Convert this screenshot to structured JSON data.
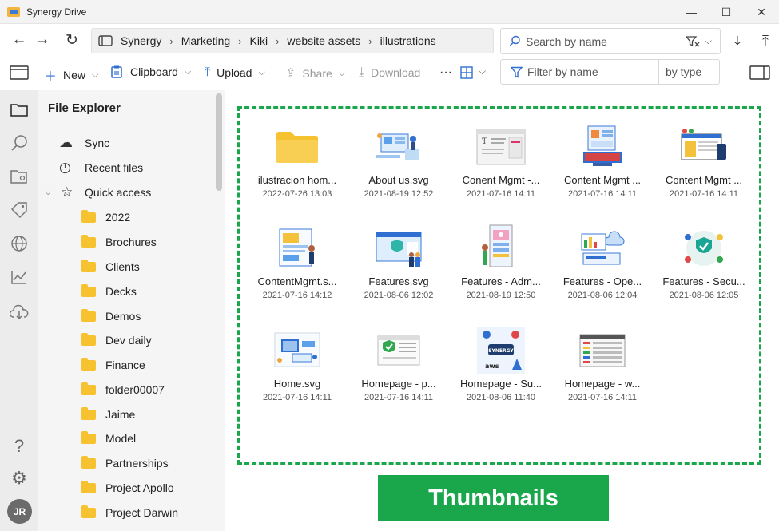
{
  "window": {
    "title": "Synergy Drive",
    "minimize": "—",
    "maximize": "☐",
    "close": "✕"
  },
  "nav": {
    "back": "←",
    "forward": "→",
    "refresh": "↻",
    "breadcrumb": [
      "Synergy",
      "Marketing",
      "Kiki",
      "website assets",
      "illustrations"
    ],
    "search_placeholder": "Search by name",
    "download": "⤓",
    "upload": "⤒"
  },
  "toolbar": {
    "new_label": "New",
    "clipboard_label": "Clipboard",
    "upload_label": "Upload",
    "share_label": "Share",
    "download_label": "Download",
    "more": "···",
    "filter_placeholder": "Filter by name",
    "type_label": "by type"
  },
  "sidebar": {
    "title": "File Explorer",
    "sync": "Sync",
    "recent": "Recent files",
    "quick_access": "Quick access",
    "folders": [
      "2022",
      "Brochures",
      "Clients",
      "Decks",
      "Demos",
      "Dev daily",
      "Finance",
      "folder00007",
      "Jaime",
      "Model",
      "Partnerships",
      "Project Apollo",
      "Project Darwin"
    ]
  },
  "user": {
    "initials": "JR"
  },
  "files": [
    {
      "name": "ilustracion hom...",
      "date": "2022-07-26 13:03",
      "kind": "folder"
    },
    {
      "name": "About us.svg",
      "date": "2021-08-19 12:52",
      "kind": "image"
    },
    {
      "name": "Conent Mgmt -...",
      "date": "2021-07-16 14:11",
      "kind": "image"
    },
    {
      "name": "Content Mgmt ...",
      "date": "2021-07-16 14:11",
      "kind": "image"
    },
    {
      "name": "Content Mgmt ...",
      "date": "2021-07-16 14:11",
      "kind": "image"
    },
    {
      "name": "ContentMgmt.s...",
      "date": "2021-07-16 14:12",
      "kind": "image"
    },
    {
      "name": "Features.svg",
      "date": "2021-08-06 12:02",
      "kind": "image"
    },
    {
      "name": "Features - Adm...",
      "date": "2021-08-19 12:50",
      "kind": "image"
    },
    {
      "name": "Features - Ope...",
      "date": "2021-08-06 12:04",
      "kind": "image"
    },
    {
      "name": "Features - Secu...",
      "date": "2021-08-06 12:05",
      "kind": "image"
    },
    {
      "name": "Home.svg",
      "date": "2021-07-16 14:11",
      "kind": "image"
    },
    {
      "name": "Homepage - p...",
      "date": "2021-07-16 14:11",
      "kind": "image"
    },
    {
      "name": "Homepage - Su...",
      "date": "2021-08-06 11:40",
      "kind": "image"
    },
    {
      "name": "Homepage - w...",
      "date": "2021-07-16 14:11",
      "kind": "image"
    }
  ],
  "badge": {
    "label": "Thumbnails"
  },
  "colors": {
    "accent": "#2f6fd1",
    "folder": "#f6c230",
    "highlight": "#1aa64b"
  }
}
